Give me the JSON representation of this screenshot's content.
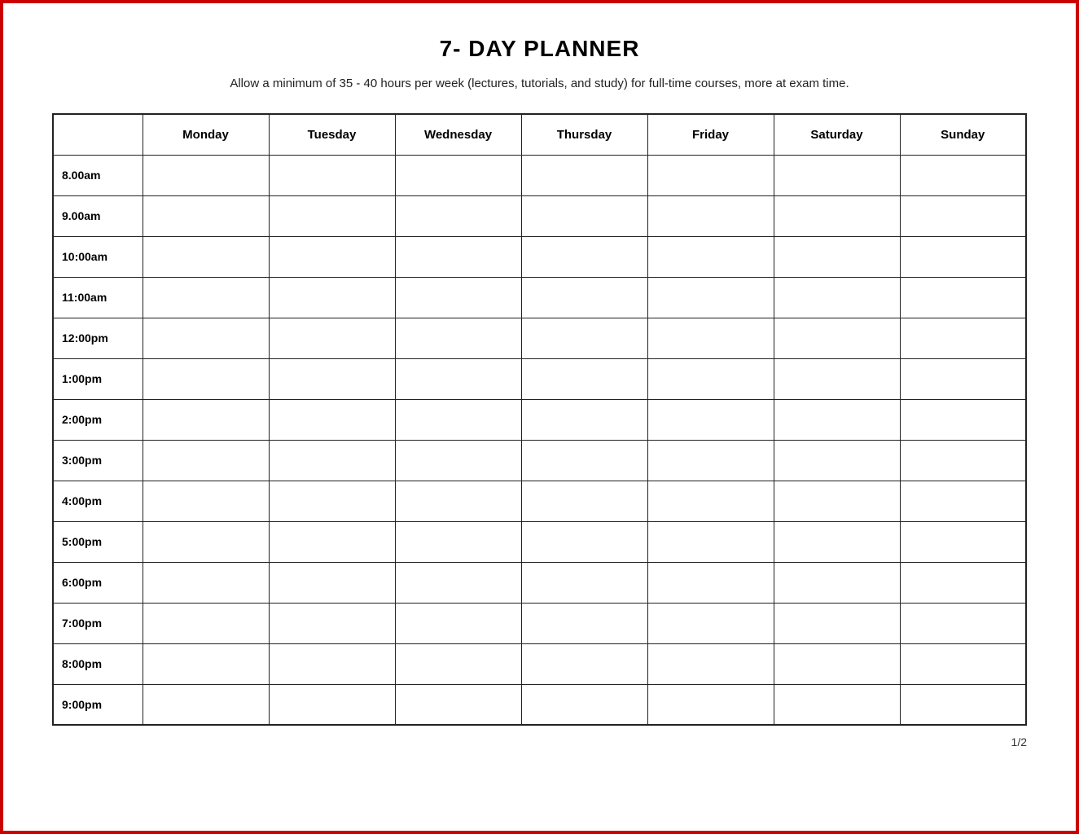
{
  "title": "7- DAY PLANNER",
  "subtitle": "Allow a minimum of 35 - 40 hours per week (lectures, tutorials, and study) for full-time courses, more at exam time.",
  "page_number": "1/2",
  "columns": [
    "",
    "Monday",
    "Tuesday",
    "Wednesday",
    "Thursday",
    "Friday",
    "Saturday",
    "Sunday"
  ],
  "time_slots": [
    "8.00am",
    "9.00am",
    "10:00am",
    "11:00am",
    "12:00pm",
    "1:00pm",
    "2:00pm",
    "3:00pm",
    "4:00pm",
    "5:00pm",
    "6:00pm",
    "7:00pm",
    "8:00pm",
    "9:00pm"
  ]
}
